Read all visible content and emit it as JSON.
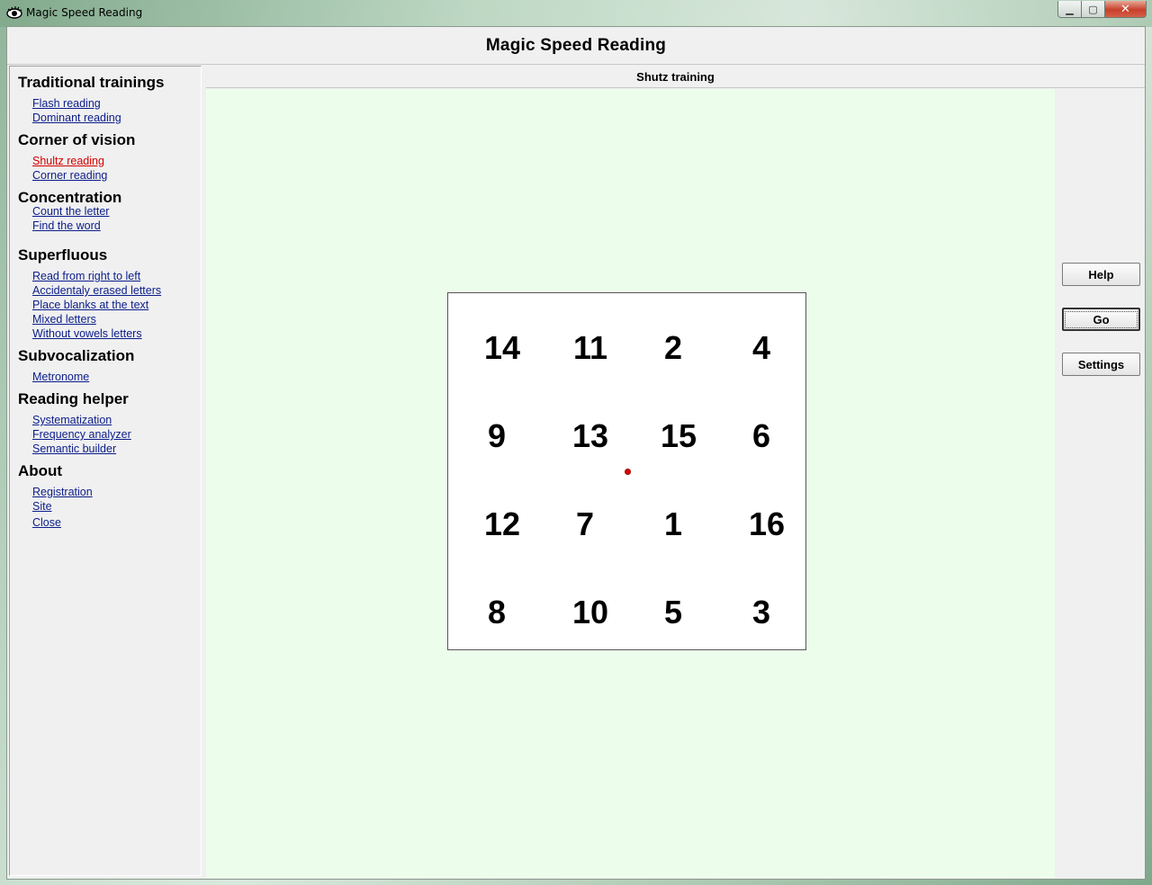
{
  "window": {
    "title": "Magic Speed Reading",
    "minimize_label": "▁",
    "maximize_label": "▢",
    "close_label": "✕"
  },
  "app": {
    "heading": "Magic Speed Reading"
  },
  "sidebar": {
    "sections": [
      {
        "title": "Traditional trainings",
        "links": [
          "Flash reading",
          "Dominant reading"
        ]
      },
      {
        "title": "Corner of vision",
        "links": [
          "Shultz reading",
          "Corner reading"
        ]
      },
      {
        "title": "Concentration",
        "links": [
          "Count the letter",
          "Find the word"
        ]
      },
      {
        "title": "Superfluous",
        "links": [
          "Read from right to left",
          "Accidentaly erased letters",
          "Place blanks at the text",
          "Mixed letters",
          "Without vowels letters"
        ]
      },
      {
        "title": "Subvocalization",
        "links": [
          "Metronome"
        ]
      },
      {
        "title": "Reading helper",
        "links": [
          "Systematization",
          "Frequency analyzer",
          "Semantic builder"
        ]
      },
      {
        "title": "About",
        "links": [
          "Registration",
          "Site",
          "Close"
        ]
      }
    ],
    "active_link": "Shultz reading",
    "active_color": "#d40000",
    "link_color": "#0b1d8a"
  },
  "main": {
    "title": "Shutz training",
    "background": "#edfdeb",
    "grid": {
      "rows": [
        [
          "14",
          "11",
          "2",
          "4"
        ],
        [
          "9",
          "13",
          "15",
          "6"
        ],
        [
          "12",
          "7",
          "1",
          "16"
        ],
        [
          "8",
          "10",
          "5",
          "3"
        ]
      ]
    }
  },
  "buttons": {
    "help": "Help",
    "go": "Go",
    "settings": "Settings"
  },
  "icons": {
    "app": "eye-icon",
    "focus": "red-dot-icon"
  }
}
